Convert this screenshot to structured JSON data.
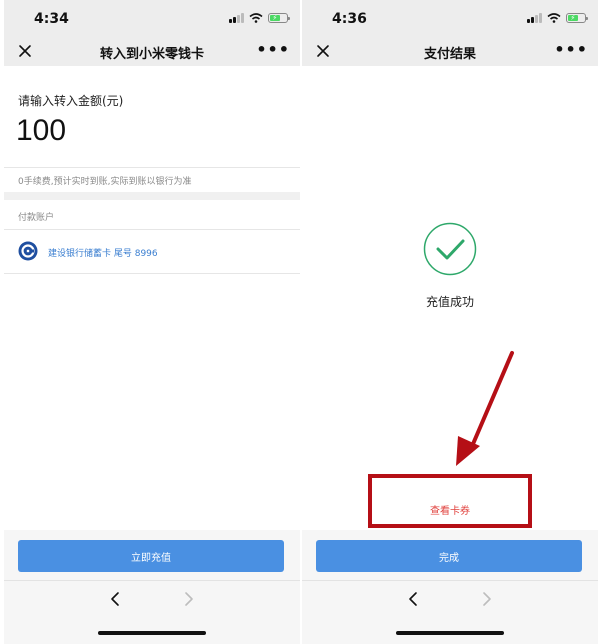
{
  "left_screen": {
    "status": {
      "time": "4:34"
    },
    "nav": {
      "title": "转入到小米零钱卡"
    },
    "amount_label": "请输入转入金额(元)",
    "amount_value": "100",
    "fee_note": "0手续费,预计实时到账,实际到账以银行为准",
    "pay_account_label": "付款账户",
    "bank_account": "建设银行储蓄卡 尾号 8996",
    "submit_button": "立即充值"
  },
  "right_screen": {
    "status": {
      "time": "4:36"
    },
    "nav": {
      "title": "支付结果"
    },
    "success_text": "充值成功",
    "card_link": "查看卡券",
    "done_button": "完成"
  },
  "icons": {
    "close": "close-icon",
    "more": "more-icon",
    "bank": "ccb-logo-icon",
    "success": "check-circle-icon",
    "back": "chevron-left-icon",
    "forward": "chevron-right-icon"
  },
  "colors": {
    "primary_button": "#4a90e2",
    "link_red": "#e0403c",
    "annotation_red": "#b50f16",
    "success_green": "#2ea86a",
    "bank_text": "#3a7ed0"
  }
}
